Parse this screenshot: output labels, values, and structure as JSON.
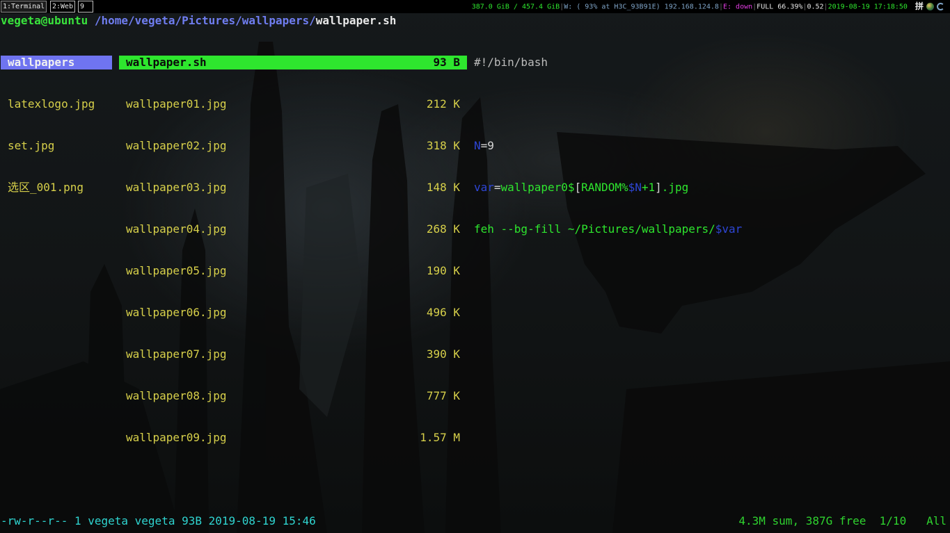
{
  "bar": {
    "workspaces": [
      "1:Terminal",
      "2:Web",
      "9"
    ],
    "disk": "387.0 GiB / 457.4 GiB",
    "wifi": "W: ( 93% at H3C_93B91E) 192.168.124.8",
    "ethernet": "E: down",
    "battery": "FULL 66.39%",
    "load": "0.52",
    "datetime": "2019-08-19 17:18:50",
    "ime": "拼",
    "tray_icons": [
      "input-method-icon",
      "globe-icon",
      "network-manager-icon"
    ],
    "colors": {
      "disk": "#2ee62e",
      "wifi": "#2ee62e",
      "ethernet": "#e03ce0",
      "battery": "#e8e8e8",
      "load": "#e8e8e8",
      "datetime": "#2ee62e"
    }
  },
  "title": {
    "host": "vegeta@ubuntu",
    "path": "/home/vegeta/Pictures/wallpapers/",
    "file": "wallpaper.sh"
  },
  "parent_column": {
    "items": [
      {
        "name": "wallpapers",
        "selected": true
      },
      {
        "name": "latexlogo.jpg"
      },
      {
        "name": "set.jpg"
      },
      {
        "name": "选区_001.png"
      }
    ]
  },
  "current_column": {
    "items": [
      {
        "name": "wallpaper.sh",
        "size": "93 B",
        "selected": true
      },
      {
        "name": "wallpaper01.jpg",
        "size": "212 K"
      },
      {
        "name": "wallpaper02.jpg",
        "size": "318 K"
      },
      {
        "name": "wallpaper03.jpg",
        "size": "148 K"
      },
      {
        "name": "wallpaper04.jpg",
        "size": "268 K"
      },
      {
        "name": "wallpaper05.jpg",
        "size": "190 K"
      },
      {
        "name": "wallpaper06.jpg",
        "size": "496 K"
      },
      {
        "name": "wallpaper07.jpg",
        "size": "390 K"
      },
      {
        "name": "wallpaper08.jpg",
        "size": "777 K"
      },
      {
        "name": "wallpaper09.jpg",
        "size": "1.57 M"
      }
    ]
  },
  "preview": {
    "line1": "#!/bin/bash",
    "line3": {
      "var": "N",
      "eq": "=",
      "val": "9"
    },
    "line4": {
      "var": "var",
      "eq": "=",
      "a": "wallpaper0$",
      "b": "[",
      "c": "RANDOM%",
      "d": "$N",
      "e": "+1",
      "f": "]",
      "g": ".jpg"
    },
    "line5": {
      "a": "feh --bg-fill ~/Pictures/wallpapers/",
      "b": "$var"
    }
  },
  "statusline": {
    "left": "-rw-r--r-- 1 vegeta vegeta 93B 2019-08-19 15:46",
    "right": "4.3M sum, 387G free  1/10   All"
  },
  "colors": {
    "selection_blue": "#6f74f0",
    "selection_green": "#2ee62e",
    "file_yellow": "#d7d04a",
    "host_green": "#39e33c",
    "path_blue": "#6f7df0"
  }
}
